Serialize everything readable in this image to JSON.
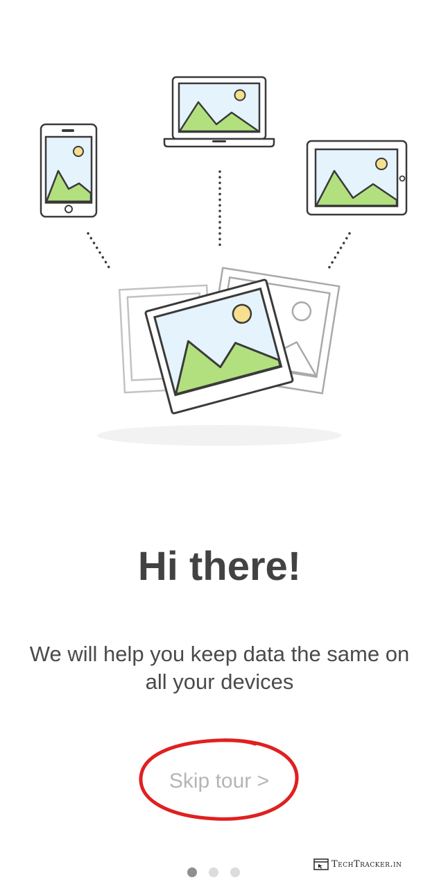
{
  "onboarding": {
    "title": "Hi there!",
    "description": "We will help you keep data the same on all your devices",
    "skip_label": "Skip tour >",
    "page_indicator": {
      "total": 3,
      "current": 1
    }
  },
  "illustration": {
    "devices": [
      "phone-icon",
      "laptop-icon",
      "tablet-icon"
    ],
    "photos": "photo-stack-icon",
    "colors": {
      "sky": "#e4f3fc",
      "mountain": "#b3e07e",
      "sun": "#f6df8e",
      "outline": "#3a3a3a",
      "faded_outline": "#b0b0b0"
    }
  },
  "annotation": {
    "highlight_color": "#e02020"
  },
  "watermark": {
    "text": "TechTracker.in"
  }
}
